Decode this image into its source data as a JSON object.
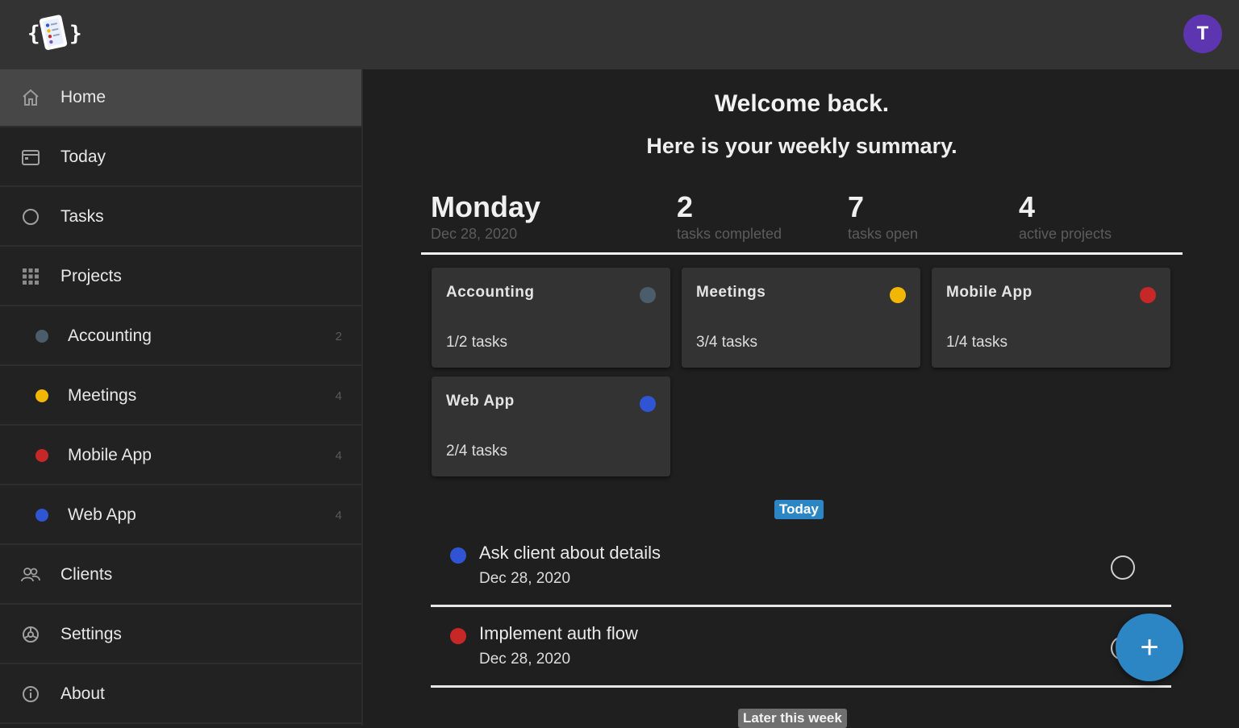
{
  "header": {
    "avatar_letter": "T",
    "avatar_color": "#5e35b1"
  },
  "sidebar": {
    "nav": [
      {
        "label": "Home",
        "icon": "home-icon"
      },
      {
        "label": "Today",
        "icon": "calendar-icon"
      },
      {
        "label": "Tasks",
        "icon": "circle-icon"
      },
      {
        "label": "Projects",
        "icon": "grid-icon"
      }
    ],
    "projects": [
      {
        "label": "Accounting",
        "count": "2",
        "color": "#4b5d6a"
      },
      {
        "label": "Meetings",
        "count": "4",
        "color": "#f2b705"
      },
      {
        "label": "Mobile App",
        "count": "4",
        "color": "#c62828"
      },
      {
        "label": "Web App",
        "count": "4",
        "color": "#2f55d4"
      }
    ],
    "bottom": [
      {
        "label": "Clients",
        "icon": "people-icon"
      },
      {
        "label": "Settings",
        "icon": "gear-icon"
      },
      {
        "label": "About",
        "icon": "info-icon"
      }
    ]
  },
  "main": {
    "welcome": "Welcome back.",
    "summary": "Here is your weekly summary.",
    "stats": {
      "day": "Monday",
      "date": "Dec 28, 2020",
      "completed_value": "2",
      "completed_label": "tasks completed",
      "open_value": "7",
      "open_label": "tasks open",
      "projects_value": "4",
      "projects_label": "active projects"
    },
    "cards": [
      {
        "title": "Accounting",
        "tasks": "1/2 tasks",
        "color": "#4b5d6a"
      },
      {
        "title": "Meetings",
        "tasks": "3/4 tasks",
        "color": "#f2b705"
      },
      {
        "title": "Mobile App",
        "tasks": "1/4 tasks",
        "color": "#c62828"
      },
      {
        "title": "Web App",
        "tasks": "2/4 tasks",
        "color": "#2f55d4"
      }
    ],
    "today_label": "Today",
    "tasks": [
      {
        "title": "Ask client about details",
        "date": "Dec 28, 2020",
        "color": "#2f55d4"
      },
      {
        "title": "Implement auth flow",
        "date": "Dec 28, 2020",
        "color": "#c62828"
      }
    ],
    "later_label": "Later this week",
    "fab_symbol": "+"
  }
}
